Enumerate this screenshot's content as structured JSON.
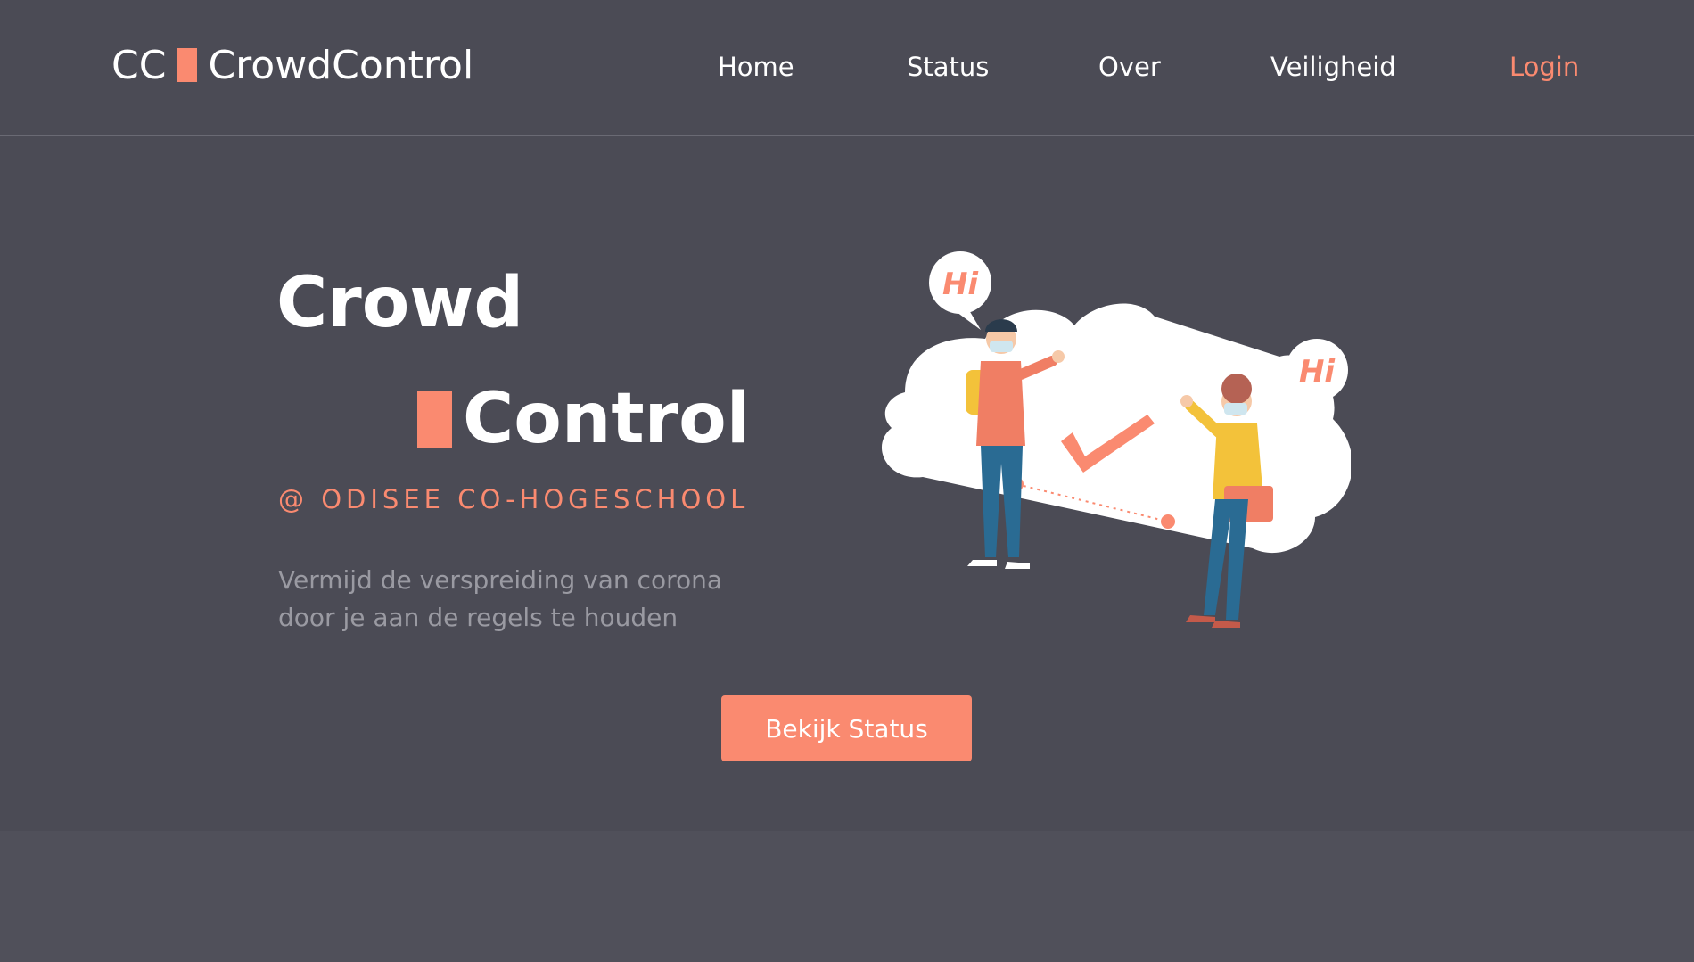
{
  "brand": {
    "abbr": "CC",
    "name": "CrowdControl",
    "accent_color": "#fa8a70"
  },
  "nav": {
    "items": [
      {
        "label": "Home"
      },
      {
        "label": "Status"
      },
      {
        "label": "Over"
      },
      {
        "label": "Veiligheid"
      },
      {
        "label": "Login"
      }
    ]
  },
  "hero": {
    "title_line1": "Crowd",
    "title_line2": "Control",
    "subtitle": "@ ODISEE CO-HOGESCHOOL",
    "description": "Vermijd de verspreiding van corona door je aan de regels te houden",
    "cta_label": "Bekijk Status",
    "illustration": {
      "bubble_left": "Hi",
      "bubble_right": "Hi"
    }
  },
  "colors": {
    "background": "#4b4b55",
    "accent": "#fa8a70",
    "text": "#ffffff",
    "muted_text": "#9a9aa2"
  }
}
